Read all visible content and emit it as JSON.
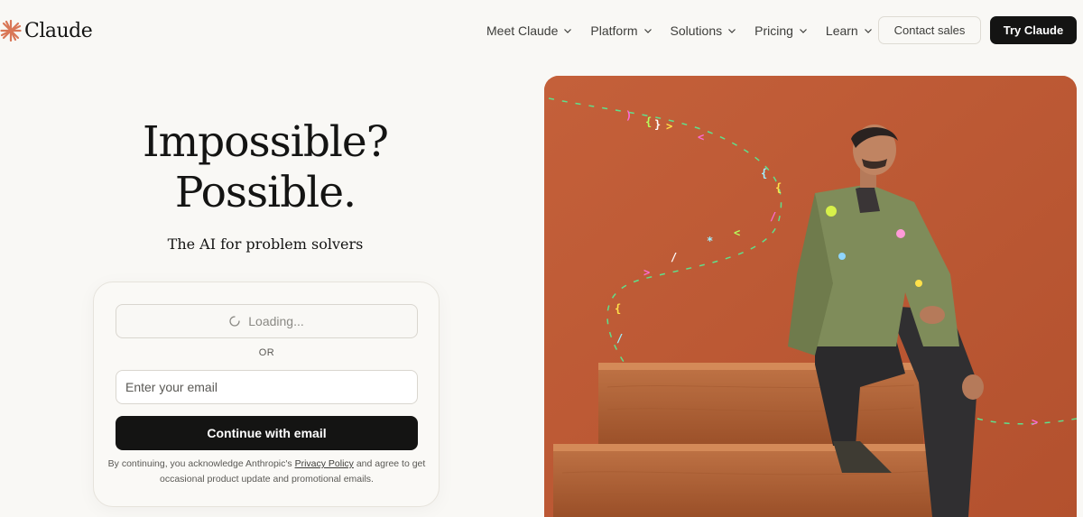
{
  "header": {
    "logo_text": "Claude",
    "nav": [
      {
        "label": "Meet Claude"
      },
      {
        "label": "Platform"
      },
      {
        "label": "Solutions"
      },
      {
        "label": "Pricing"
      },
      {
        "label": "Learn"
      }
    ],
    "contact_label": "Contact sales",
    "try_label": "Try Claude"
  },
  "hero": {
    "title_line1": "Impossible?",
    "title_line2": "Possible.",
    "subtitle": "The AI for problem solvers"
  },
  "login": {
    "loading_label": "Loading...",
    "or_label": "OR",
    "email_placeholder": "Enter your email",
    "email_value": "",
    "continue_label": "Continue with email",
    "disclaimer_before": "By continuing, you acknowledge Anthropic's ",
    "privacy_link": "Privacy Policy",
    "disclaimer_after": " and agree to get occasional product update and promotional emails."
  },
  "colors": {
    "accent": "#d97757",
    "background": "#f9f8f5",
    "dark": "#141413",
    "image_bg": "#c35e38"
  },
  "icons": {
    "logo": "claude-spark-icon",
    "chevron": "chevron-down-icon",
    "spinner": "spinner-icon"
  }
}
